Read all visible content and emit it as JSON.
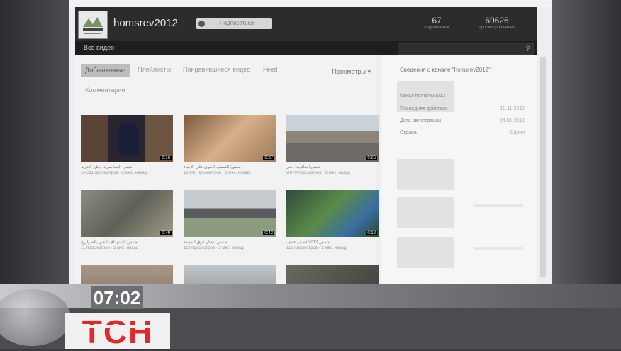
{
  "channel": {
    "name": "homsrev2012",
    "subscribe_label": "Подписаться",
    "stats": [
      {
        "value": "67",
        "label": "подписчиков"
      },
      {
        "value": "69626",
        "label": "просмотров видео"
      }
    ]
  },
  "nav": {
    "all_videos": "Все видео"
  },
  "tabs": [
    "Добавленные",
    "Плейлисты",
    "Понравившиеся видео",
    "Feed",
    "Комментарии"
  ],
  "sort_label": "Просмотры ▾",
  "sidebar": {
    "title": "Сведения о канале \"homsrev2012\"",
    "rows": [
      {
        "label": "Канал homsrev2012",
        "value": ""
      },
      {
        "label": "Последняя действие",
        "value": "18.11.2012"
      },
      {
        "label": "Дата регистрации",
        "value": "24.01.2012"
      },
      {
        "label": "Страна",
        "value": "Сирия"
      }
    ]
  },
  "videos": [
    {
      "duration": "0:16",
      "title": "حمص المحاصرة: وطن الحرية",
      "meta": "10 311 просмотров · 2 мес. назад"
    },
    {
      "duration": "0:37",
      "title": "حمص: القصف الجوي على الأحياء",
      "meta": "12 045 просмотров · 2 мес. назад"
    },
    {
      "duration": "0:26",
      "title": "حمص الخالدية: دمار",
      "meta": "9 870 просмотров · 2 мес. назад"
    },
    {
      "duration": "0:49",
      "title": "حمص: استهداف الحي بالصواريخ",
      "meta": "11 просмотров · 2 мес. назад"
    },
    {
      "duration": "0:42",
      "title": "حمص: دخان فوق المدينة",
      "meta": "119 просмотров · 2 мес. назад"
    },
    {
      "duration": "0:12",
      "title": "حمص 2012 قصف عنيف",
      "meta": "112 просмотров · 2 мес. назад"
    },
    {
      "duration": "",
      "title": "",
      "meta": ""
    },
    {
      "duration": "",
      "title": "",
      "meta": ""
    },
    {
      "duration": "",
      "title": "",
      "meta": ""
    }
  ],
  "overlay": {
    "time": "07:02",
    "logo": "ТСН"
  }
}
